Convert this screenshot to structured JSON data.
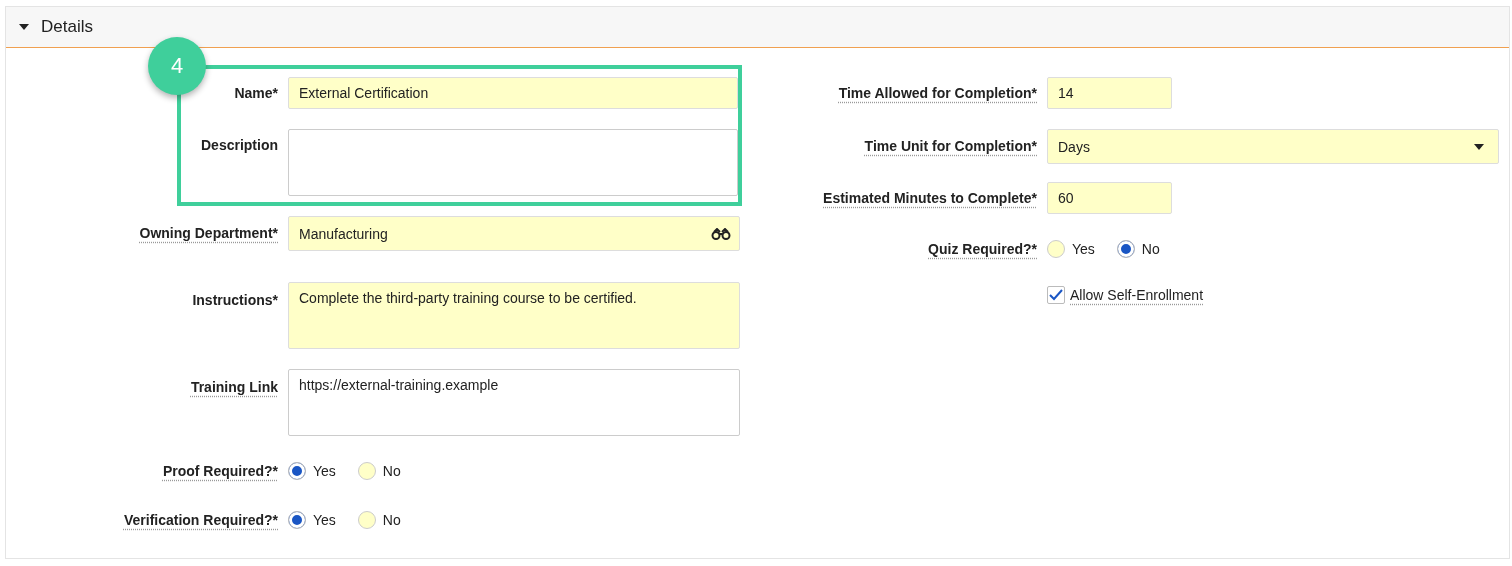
{
  "section": {
    "title": "Details",
    "expanded": true
  },
  "callout": {
    "badge": "4",
    "fields": [
      {
        "kind": "text",
        "label": "Name*",
        "help": false,
        "value": "External Certification",
        "required_fill": true
      },
      {
        "kind": "textarea",
        "label": "Description",
        "help": false,
        "required_fill": false
      }
    ]
  },
  "left_fields": [
    {
      "kind": "lookup",
      "label": "Owning Department*",
      "help": true,
      "value": "Manufacturing",
      "required_fill": true
    },
    {
      "kind": "textarea",
      "label": "Instructions*",
      "help": false,
      "value": "Complete the third-party training course to be certified.",
      "required_fill": true
    },
    {
      "kind": "textarea",
      "label": "Training Link",
      "help": true,
      "value": "https://external-training.example",
      "required_fill": false
    },
    {
      "kind": "radio",
      "label": "Proof Required?*",
      "help": true,
      "options": [
        {
          "label": "Yes",
          "selected": true
        },
        {
          "label": "No",
          "selected": false
        }
      ]
    },
    {
      "kind": "radio",
      "label": "Verification Required?*",
      "help": true,
      "options": [
        {
          "label": "Yes",
          "selected": true
        },
        {
          "label": "No",
          "selected": false
        }
      ]
    }
  ],
  "right_fields": [
    {
      "kind": "text",
      "label": "Time Allowed for Completion*",
      "help": true,
      "value": "14",
      "required_fill": true
    },
    {
      "kind": "select",
      "label": "Time Unit for Completion*",
      "help": true,
      "value": "Days",
      "required_fill": true
    },
    {
      "kind": "text",
      "label": "Estimated Minutes to Complete*",
      "help": true,
      "value": "60",
      "required_fill": true
    },
    {
      "kind": "radio",
      "label": "Quiz Required?*",
      "help": true,
      "options": [
        {
          "label": "Yes",
          "selected": false
        },
        {
          "label": "No",
          "selected": true
        }
      ]
    },
    {
      "kind": "checkbox",
      "label": "Allow Self-Enrollment",
      "help": true,
      "checked": true
    }
  ]
}
